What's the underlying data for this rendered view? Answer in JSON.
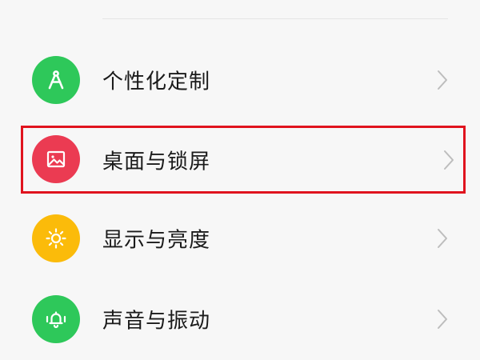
{
  "settings": {
    "items": [
      {
        "label": "个性化定制",
        "icon": "compass-icon",
        "color": "#22c55e"
      },
      {
        "label": "桌面与锁屏",
        "icon": "picture-icon",
        "color": "#ee3b52",
        "highlighted": true
      },
      {
        "label": "显示与亮度",
        "icon": "brightness-sun-icon",
        "color": "#fbbd08"
      },
      {
        "label": "声音与振动",
        "icon": "bell-vibrate-icon",
        "color": "#22c55e"
      }
    ]
  },
  "colors": {
    "highlight_border": "#e0131e",
    "background": "#f7f7f7",
    "chevron": "#bdbdbd"
  }
}
